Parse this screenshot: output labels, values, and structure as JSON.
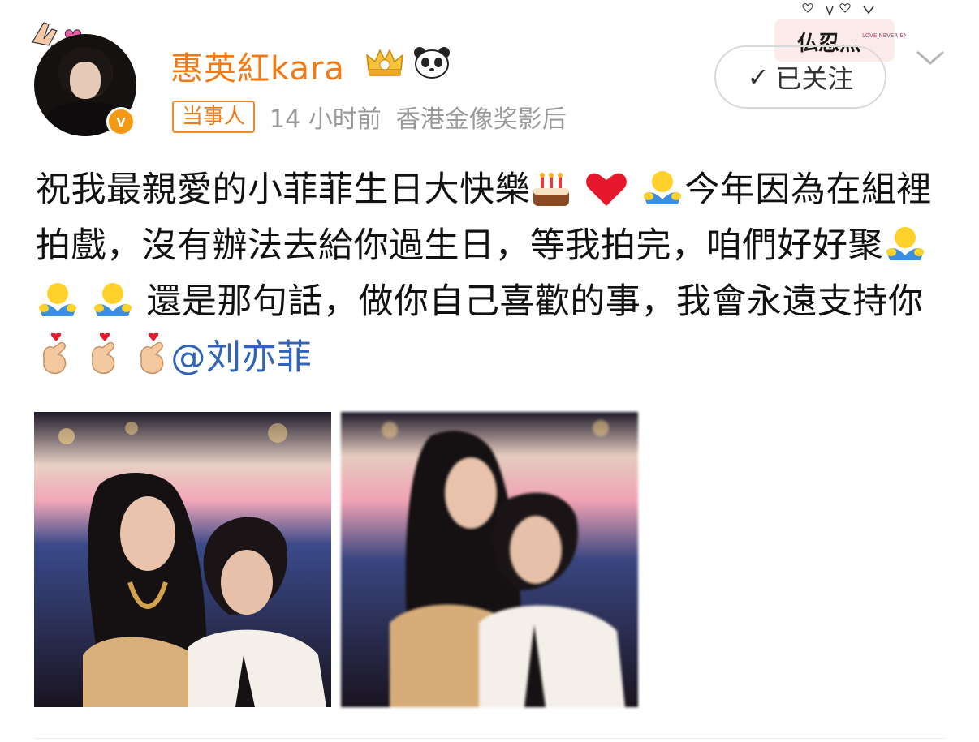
{
  "post": {
    "author_name": "惠英紅kara",
    "tag": "当事人",
    "time": "14 小时前",
    "source": "香港金像奖影后",
    "follow_label": "已关注",
    "text_part1": "祝我最親愛的小菲菲生日大快樂",
    "text_part2": "今年因為在組裡拍戲，沒有辦法去給你過生日，等我拍完，咱們好好聚",
    "text_part3": " 還是那句話，做你自己喜歡的事，我會永遠支持你",
    "mention": "@刘亦菲",
    "sticker_text": "LOVE NEVER ENDS"
  },
  "colors": {
    "accent_orange": "#f07b15",
    "link_blue": "#2f64b8",
    "meta_gray": "#9a9a9a"
  },
  "icons": [
    "avatar-decoration-icon",
    "verified-icon",
    "crown-badge-icon",
    "panda-icon",
    "checkmark-icon",
    "chevron-down-icon",
    "cake-emoji",
    "heart-emoji",
    "hug-emoji",
    "finger-heart-emoji"
  ]
}
